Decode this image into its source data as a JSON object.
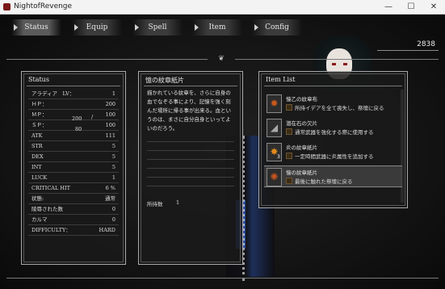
{
  "window": {
    "title": "NightofRevenge",
    "minimize": "—",
    "maximize": "☐",
    "close": "✕"
  },
  "tabs": [
    {
      "label": "Status",
      "active": true
    },
    {
      "label": "Equip",
      "active": false
    },
    {
      "label": "Spell",
      "active": false
    },
    {
      "label": "Item",
      "active": false
    },
    {
      "label": "Config",
      "active": false
    }
  ],
  "gold": "2838",
  "status": {
    "title": "Status",
    "rows": [
      {
        "label": "アラディア　LV：",
        "value": "1"
      },
      {
        "label": "ＨＰ：",
        "value": "200"
      },
      {
        "label": "ＭＰ：",
        "value": "100"
      },
      {
        "label": "ＳＰ：",
        "value": "100"
      },
      {
        "label": "ATK",
        "value": "111"
      },
      {
        "label": "STR",
        "value": "5"
      },
      {
        "label": "DEX",
        "value": "5"
      },
      {
        "label": "INT",
        "value": "5"
      },
      {
        "label": "LUCK",
        "value": "1"
      },
      {
        "label": "CRITICAL HIT",
        "value": "6 %"
      },
      {
        "label": "状態:",
        "value": "通常"
      },
      {
        "label": "陵辱された数",
        "value": "0"
      },
      {
        "label": "カルマ",
        "value": "0"
      },
      {
        "label": "DIFFICULTY：",
        "value": "HARD"
      }
    ],
    "mp_current": "200",
    "sp_current": "80",
    "slash": "/"
  },
  "detail": {
    "title": "憶の紋章紙片",
    "description": "描かれている紋章を、さらに自身の血でなぞる事により、記憶を強く刻んだ場所に帰る事が出来る。血というのは、まさに自分自身といってよいのだろう。",
    "held_label": "所持数",
    "held_value": "1"
  },
  "item_list": {
    "title": "Item List",
    "items": [
      {
        "name": "憶乙の紋章布",
        "description": "所持イデアを全て喪失し、祭壇に戻る",
        "icon": "scroll-icon",
        "color": "#c85a1e",
        "qty": "",
        "selected": false
      },
      {
        "name": "潜在石の欠片",
        "description": "通常武器を強化する際に使用する",
        "icon": "shard-icon",
        "color": "#9a9a9a",
        "qty": "",
        "selected": false
      },
      {
        "name": "炎の紋章紙片",
        "description": "一定時間武器に炎属性を追加する",
        "icon": "flame-scroll-icon",
        "color": "#d07a1c",
        "qty": "3",
        "selected": false
      },
      {
        "name": "憶の紋章紙片",
        "description": "最後に触れた祭壇に戻る",
        "icon": "memory-scroll-icon",
        "color": "#c8541e",
        "qty": "",
        "selected": true
      }
    ]
  }
}
